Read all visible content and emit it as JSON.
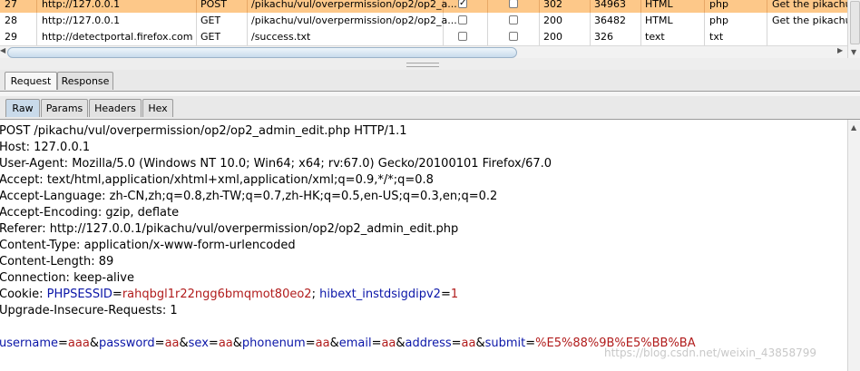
{
  "history": {
    "rows": [
      {
        "num": "27",
        "host": "http://127.0.0.1",
        "method": "POST",
        "url": "/pikachu/vul/overpermission/op2/op2_a...",
        "params": true,
        "edited": false,
        "status": "302",
        "length": "34963",
        "mime": "HTML",
        "ext": "php",
        "title": "Get the pikachu",
        "selected": true
      },
      {
        "num": "28",
        "host": "http://127.0.0.1",
        "method": "GET",
        "url": "/pikachu/vul/overpermission/op2/op2_a...",
        "params": false,
        "edited": false,
        "status": "200",
        "length": "36482",
        "mime": "HTML",
        "ext": "php",
        "title": "Get the pikachu",
        "selected": false
      },
      {
        "num": "29",
        "host": "http://detectportal.firefox.com",
        "method": "GET",
        "url": "/success.txt",
        "params": false,
        "edited": false,
        "status": "200",
        "length": "326",
        "mime": "text",
        "ext": "txt",
        "title": "",
        "selected": false
      }
    ]
  },
  "tabs_main": [
    {
      "label": "Request",
      "active": true
    },
    {
      "label": "Response",
      "active": false
    }
  ],
  "tabs_sub": [
    {
      "label": "Raw",
      "active": true
    },
    {
      "label": "Params",
      "active": false
    },
    {
      "label": "Headers",
      "active": false
    },
    {
      "label": "Hex",
      "active": false
    }
  ],
  "request": {
    "lines": [
      "POST /pikachu/vul/overpermission/op2/op2_admin_edit.php HTTP/1.1",
      "Host: 127.0.0.1",
      "User-Agent: Mozilla/5.0 (Windows NT 10.0; Win64; x64; rv:67.0) Gecko/20100101 Firefox/67.0",
      "Accept: text/html,application/xhtml+xml,application/xml;q=0.9,*/*;q=0.8",
      "Accept-Language: zh-CN,zh;q=0.8,zh-TW;q=0.7,zh-HK;q=0.5,en-US;q=0.3,en;q=0.2",
      "Accept-Encoding: gzip, deflate",
      "Referer: http://127.0.0.1/pikachu/vul/overpermission/op2/op2_admin_edit.php",
      "Content-Type: application/x-www-form-urlencoded",
      "Content-Length: 89",
      "Connection: keep-alive"
    ],
    "cookie": {
      "prefix": "Cookie: ",
      "parts": [
        {
          "name": "PHPSESSID",
          "eq": "=",
          "value": "rahqbgl1r22ngg6bmqmot80eo2"
        },
        {
          "sep": "; "
        },
        {
          "name": "hibext_instdsigdipv2",
          "eq": "=",
          "value": "1"
        }
      ]
    },
    "after_cookie": "Upgrade-Insecure-Requests: 1",
    "body": [
      {
        "name": "username",
        "value": "aaa"
      },
      {
        "name": "password",
        "value": "aa"
      },
      {
        "name": "sex",
        "value": "aa"
      },
      {
        "name": "phonenum",
        "value": "aa"
      },
      {
        "name": "email",
        "value": "aa"
      },
      {
        "name": "address",
        "value": "aa"
      },
      {
        "name": "submit",
        "value": "%E5%88%9B%E5%BB%BA"
      }
    ],
    "body_eq": "=",
    "body_amp": "&"
  },
  "watermark": "https://blog.csdn.net/weixin_43858799"
}
